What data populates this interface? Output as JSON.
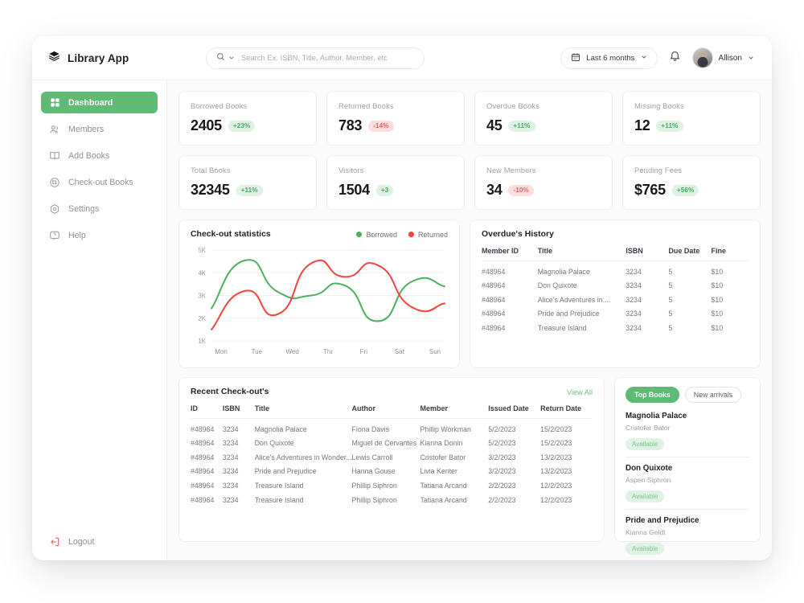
{
  "header": {
    "brand": "Library App",
    "logo_icon": "stack-icon",
    "search": {
      "placeholder": "Search Ex. ISBN, Title, Author, Member, etc",
      "value": "",
      "icon": "search-icon",
      "chevron": "chevron-down-icon"
    },
    "date_filter": {
      "label": "Last 6 months",
      "icon": "calendar-icon",
      "chevron": "chevron-down-icon"
    },
    "notification_icon": "bell-icon",
    "user": {
      "name": "Allison",
      "avatar": "user-avatar",
      "chevron": "chevron-down-icon"
    }
  },
  "sidebar": {
    "items": [
      {
        "label": "Dashboard",
        "icon": "grid-icon",
        "active": true
      },
      {
        "label": "Members",
        "icon": "users-icon",
        "active": false
      },
      {
        "label": "Add Books",
        "icon": "open-book-icon",
        "active": false
      },
      {
        "label": "Check-out Books",
        "icon": "circle-book-icon",
        "active": false
      },
      {
        "label": "Settings",
        "icon": "gear-icon",
        "active": false
      },
      {
        "label": "Help",
        "icon": "help-icon",
        "active": false
      }
    ],
    "logout": {
      "label": "Logout",
      "icon": "logout-icon"
    }
  },
  "stats": [
    {
      "label": "Borrowed Books",
      "value": "2405",
      "delta": "+23%",
      "dir": "up"
    },
    {
      "label": "Returned Books",
      "value": "783",
      "delta": "-14%",
      "dir": "down"
    },
    {
      "label": "Overdue Books",
      "value": "45",
      "delta": "+11%",
      "dir": "up"
    },
    {
      "label": "Missing Books",
      "value": "12",
      "delta": "+11%",
      "dir": "up"
    },
    {
      "label": "Total Books",
      "value": "32345",
      "delta": "+11%",
      "dir": "up"
    },
    {
      "label": "Visitors",
      "value": "1504",
      "delta": "+3",
      "dir": "up"
    },
    {
      "label": "New Members",
      "value": "34",
      "delta": "-10%",
      "dir": "down"
    },
    {
      "label": "Pending Fees",
      "value": "$765",
      "delta": "+56%",
      "dir": "up"
    }
  ],
  "chart_data": {
    "type": "line",
    "title": "Check-out statistics",
    "xlabel": "",
    "ylabel": "",
    "categories": [
      "Mon",
      "Tue",
      "Wed",
      "Thr",
      "Fri",
      "Sat",
      "Sun"
    ],
    "ylim": [
      1000,
      5000
    ],
    "ytick_labels": [
      "5K",
      "4K",
      "3K",
      "2K",
      "1K"
    ],
    "ytick_values": [
      5000,
      4000,
      3000,
      2000,
      1000
    ],
    "grid": true,
    "legend_position": "top-right",
    "series": [
      {
        "name": "Borrowed",
        "color": "#4caf5e",
        "values": [
          2430,
          4540,
          3150,
          3000,
          3440,
          1870,
          3600,
          3400
        ]
      },
      {
        "name": "Returned",
        "color": "#f4433a",
        "values": [
          1500,
          3200,
          2180,
          4420,
          3820,
          4330,
          2500,
          2650
        ]
      }
    ]
  },
  "overdue": {
    "title": "Overdue's History",
    "columns": [
      "Member ID",
      "Title",
      "ISBN",
      "Due Date",
      "Fine"
    ],
    "rows": [
      [
        "#48964",
        "Magnolia Palace",
        "3234",
        "5",
        "$10"
      ],
      [
        "#48964",
        "Don Quixote",
        "3234",
        "5",
        "$10"
      ],
      [
        "#48964",
        "Alice's Adventures in....",
        "3234",
        "5",
        "$10"
      ],
      [
        "#48964",
        "Pride and Prejudice",
        "3234",
        "5",
        "$10"
      ],
      [
        "#48964",
        "Treasure Island",
        "3234",
        "5",
        "$10"
      ]
    ]
  },
  "recent": {
    "title": "Recent Check-out's",
    "view_all": "View All",
    "columns": [
      "ID",
      "ISBN",
      "Title",
      "Author",
      "Member",
      "Issued Date",
      "Return Date"
    ],
    "rows": [
      [
        "#48964",
        "3234",
        "Magnolia Palace",
        "Fiona Davis",
        "Phillip Workman",
        "5/2/2023",
        "15/2/2023"
      ],
      [
        "#48964",
        "3234",
        "Don Quixote",
        "Miguel de Cervantes",
        "Kianna Donin",
        "5/2/2023",
        "15/2/2023"
      ],
      [
        "#48964",
        "3234",
        "Alice's Adventures in Wonder...",
        "Lewis Carroll",
        "Cristofer Bator",
        "3/2/2023",
        "13/2/2023"
      ],
      [
        "#48964",
        "3234",
        "Pride and Prejudice",
        "Hanna Gouse",
        "Livia Kenter",
        "3/2/2023",
        "13/2/2023"
      ],
      [
        "#48964",
        "3234",
        "Treasure Island",
        "Phillip Siphron",
        "Tatiana Arcand",
        "2/2/2023",
        "12/2/2023"
      ],
      [
        "#48964",
        "3234",
        "Treasure Island",
        "Phillip Siphron",
        "Tatiana Arcand",
        "2/2/2023",
        "12/2/2023"
      ]
    ]
  },
  "top_books": {
    "tabs": [
      {
        "label": "Top Books",
        "selected": true
      },
      {
        "label": "New arrivals",
        "selected": false
      }
    ],
    "books": [
      {
        "title": "Magnolia Palace",
        "author": "Cristofer Bator",
        "status": "Available"
      },
      {
        "title": "Don Quixote",
        "author": "Aspen Siphron",
        "status": "Available"
      },
      {
        "title": "Pride and Prejudice",
        "author": "Kianna Geidt",
        "status": "Available"
      }
    ]
  },
  "colors": {
    "accent_green": "#5fbb74",
    "line_green": "#4caf5e",
    "line_red": "#f4433a",
    "badge_up_bg": "#dff2e3",
    "badge_down_bg": "#fbdedd",
    "logout_red": "#f4605a"
  }
}
